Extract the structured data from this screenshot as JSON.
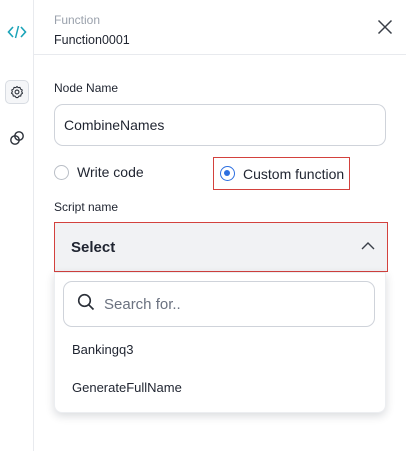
{
  "header": {
    "subtitle": "Function",
    "title": "Function0001"
  },
  "rail": {
    "icons": [
      "code-icon",
      "gear-icon",
      "link-icon"
    ]
  },
  "form": {
    "node_name_label": "Node Name",
    "node_name_value": "CombineNames",
    "radio_write": "Write code",
    "radio_custom": "Custom function",
    "selected_radio": "Custom function",
    "script_label": "Script name",
    "select_value": "Select",
    "search_placeholder": "Search for..",
    "options": [
      "Bankingq3",
      "GenerateFullName"
    ]
  },
  "colors": {
    "accent": "#2d6fe0",
    "highlight": "#d3413d",
    "code_icon": "#1aa3b8"
  }
}
